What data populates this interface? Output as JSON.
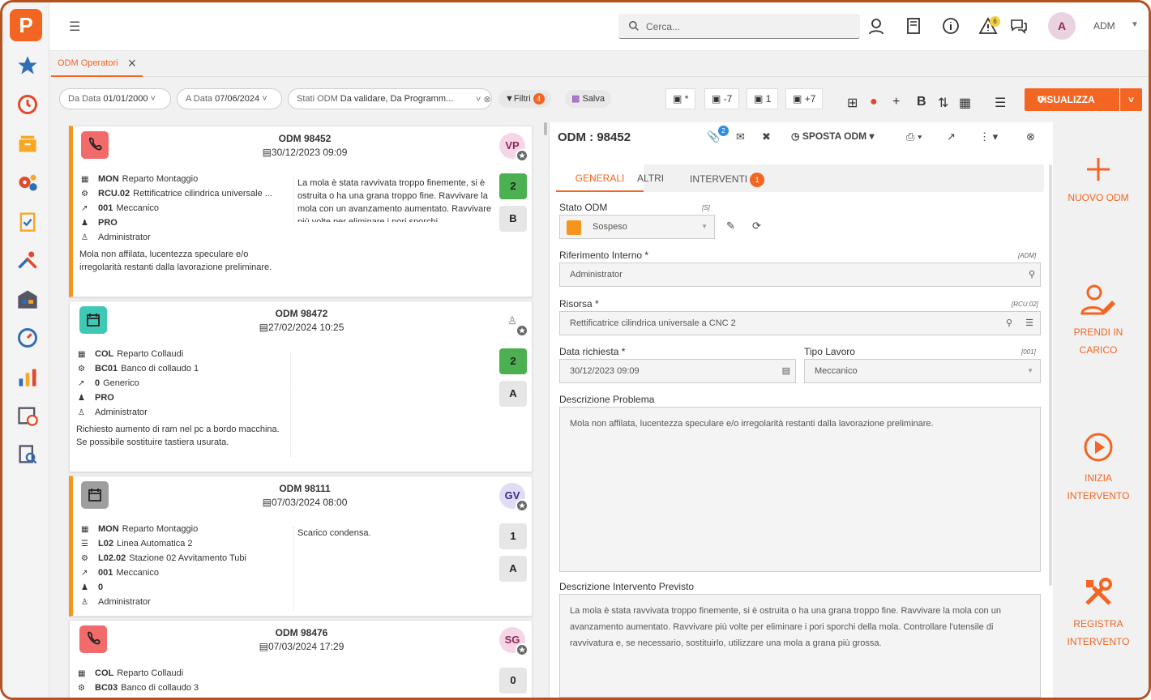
{
  "app": {
    "logo": "P"
  },
  "topbar": {
    "search_placeholder": "Cerca...",
    "notif_count": "6",
    "avatar": "A",
    "user": "ADM"
  },
  "tabs": [
    {
      "label": "ODM Operatori"
    }
  ],
  "filters": {
    "da_data_label": "Da Data",
    "da_data_value": "01/01/2000",
    "a_data_label": "A Data",
    "a_data_value": "07/06/2024",
    "stati_label": "Stati ODM",
    "stati_value": "Da validare, Da Programm...",
    "filtri_label": "Filtri",
    "filtri_count": "4",
    "salva_label": "Salva",
    "date_btns": [
      "*",
      "-7",
      "1",
      "+7"
    ],
    "visualizza": "VISUALIZZA"
  },
  "cards": [
    {
      "title": "ODM 98452",
      "date": "30/12/2023 09:09",
      "avatar": "VP",
      "icon": "phone-icon",
      "rows": [
        {
          "code": "MON",
          "text": "Reparto Montaggio"
        },
        {
          "code": "RCU.02",
          "text": "Rettificatrice cilindrica universale ..."
        },
        {
          "code": "001",
          "text": "Meccanico"
        },
        {
          "code": "PRO",
          "text": ""
        },
        {
          "code": "",
          "text": "Administrator"
        }
      ],
      "desc": "Mola non affilata, lucentezza speculare e/o irregolarità restanti dalla lavorazione preliminare.",
      "note": "La mola è stata ravvivata troppo finemente, si è ostruita o ha una grana troppo fine. Ravvivare la mola con un avanzamento aumentato. Ravvivare più volte per eliminare i pori sporchi",
      "box1": "2",
      "box2": "B"
    },
    {
      "title": "ODM 98472",
      "date": "27/02/2024 10:25",
      "avatar": "",
      "icon": "calendar-icon",
      "rows": [
        {
          "code": "COL",
          "text": "Reparto Collaudi"
        },
        {
          "code": "BC01",
          "text": "Banco di collaudo 1"
        },
        {
          "code": "0",
          "text": "Generico"
        },
        {
          "code": "PRO",
          "text": ""
        },
        {
          "code": "",
          "text": "Administrator"
        }
      ],
      "desc": "Richiesto aumento di ram nel pc a bordo macchina. Se possibile sostituire tastiera usurata.",
      "note": "",
      "box1": "2",
      "box2": "A"
    },
    {
      "title": "ODM 98111",
      "date": "07/03/2024 08:00",
      "avatar": "GV",
      "icon": "calendar-icon",
      "rows": [
        {
          "code": "MON",
          "text": "Reparto Montaggio"
        },
        {
          "code": "L02",
          "text": "Linea Automatica 2"
        },
        {
          "code": "L02.02",
          "text": "Stazione 02 Avvitamento Tubi"
        },
        {
          "code": "001",
          "text": "Meccanico"
        },
        {
          "code": "0",
          "text": ""
        },
        {
          "code": "",
          "text": "Administrator"
        }
      ],
      "desc": "",
      "note": "Scarico condensa.",
      "box1": "1",
      "box2": "A"
    },
    {
      "title": "ODM 98476",
      "date": "07/03/2024 17:29",
      "avatar": "SG",
      "icon": "phone-icon",
      "rows": [
        {
          "code": "COL",
          "text": "Reparto Collaudi"
        },
        {
          "code": "BC03",
          "text": "Banco di collaudo 3"
        }
      ],
      "desc": "",
      "note": "",
      "box1": "0",
      "box2": ""
    }
  ],
  "detail": {
    "title": "ODM : 98452",
    "attach_count": "2",
    "sposta": "SPOSTA ODM",
    "tabs": [
      "GENERALI",
      "ALTRI",
      "INTERVENTI"
    ],
    "interventi_count": "1",
    "stato_label": "Stato ODM",
    "stato_ref": "[S]",
    "stato_value": "Sospeso",
    "stato_color": "#f7941d",
    "rif_label": "Riferimento Interno *",
    "rif_ref": "[ADM]",
    "rif_value": "Administrator",
    "risorsa_label": "Risorsa *",
    "risorsa_ref": "[RCU.02]",
    "risorsa_value": "Rettificatrice cilindrica universale a CNC 2",
    "data_label": "Data richiesta *",
    "data_value": "30/12/2023 09:09",
    "tipo_label": "Tipo Lavoro",
    "tipo_ref": "[001]",
    "tipo_value": "Meccanico",
    "descprob_label": "Descrizione Problema",
    "descprob_value": "Mola non affilata, lucentezza speculare e/o irregolarità restanti dalla lavorazione preliminare.",
    "descint_label": "Descrizione Intervento Previsto",
    "descint_value": "La mola è stata ravvivata troppo finemente, si è ostruita o ha una grana troppo fine. Ravvivare la mola con un avanzamento aumentato. Ravvivare più volte per eliminare i pori sporchi della mola. Controllare l'utensile di ravvivatura e, se necessario, sostituirlo, utilizzare una mola a grana più grossa."
  },
  "actions": [
    {
      "label1": "NUOVO ODM",
      "label2": ""
    },
    {
      "label1": "PRENDI IN",
      "label2": "CARICO"
    },
    {
      "label1": "INIZIA",
      "label2": "INTERVENTO"
    },
    {
      "label1": "REGISTRA",
      "label2": "INTERVENTO"
    }
  ],
  "colors": {
    "accent": "#f26522",
    "orange": "#f7941d",
    "green": "#4caf50",
    "phone": "#f26b6b",
    "teal": "#3ec9b6",
    "gray": "#9e9e9e"
  }
}
